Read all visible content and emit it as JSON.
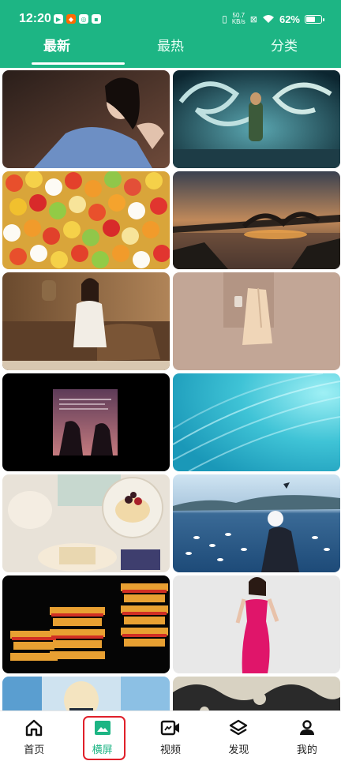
{
  "status_bar": {
    "time": "12:20",
    "net_speed_value": "50.7",
    "net_speed_unit": "KB/s",
    "battery_percent": "62%",
    "battery_level": 0.62
  },
  "tabs": [
    {
      "label": "最新",
      "active": true
    },
    {
      "label": "最热",
      "active": false
    },
    {
      "label": "分类",
      "active": false
    }
  ],
  "wallpapers": [
    {
      "subject": "woman-in-blue-blazer"
    },
    {
      "subject": "fantasy-dragon-warrior"
    },
    {
      "subject": "gummy-bears"
    },
    {
      "subject": "bridge-at-sunset"
    },
    {
      "subject": "woman-in-white-dress-on-sofa"
    },
    {
      "subject": "coat-and-coffee-minimal"
    },
    {
      "subject": "dark-book-cover-couple"
    },
    {
      "subject": "turquoise-swirl"
    },
    {
      "subject": "cake-and-cat"
    },
    {
      "subject": "lake-with-birds"
    },
    {
      "subject": "chinese-pavilion-night"
    },
    {
      "subject": "woman-in-pink-dress"
    },
    {
      "subject": "anime-girl"
    },
    {
      "subject": "ink-wave-pattern"
    }
  ],
  "bottom_nav": [
    {
      "label": "首页",
      "icon": "home-icon",
      "active": false
    },
    {
      "label": "横屏",
      "icon": "image-icon",
      "active": true
    },
    {
      "label": "视频",
      "icon": "video-icon",
      "active": false
    },
    {
      "label": "发现",
      "icon": "layers-icon",
      "active": false
    },
    {
      "label": "我的",
      "icon": "user-icon",
      "active": false
    }
  ],
  "colors": {
    "brand_green": "#1db584",
    "highlight_red": "#e0202a"
  }
}
